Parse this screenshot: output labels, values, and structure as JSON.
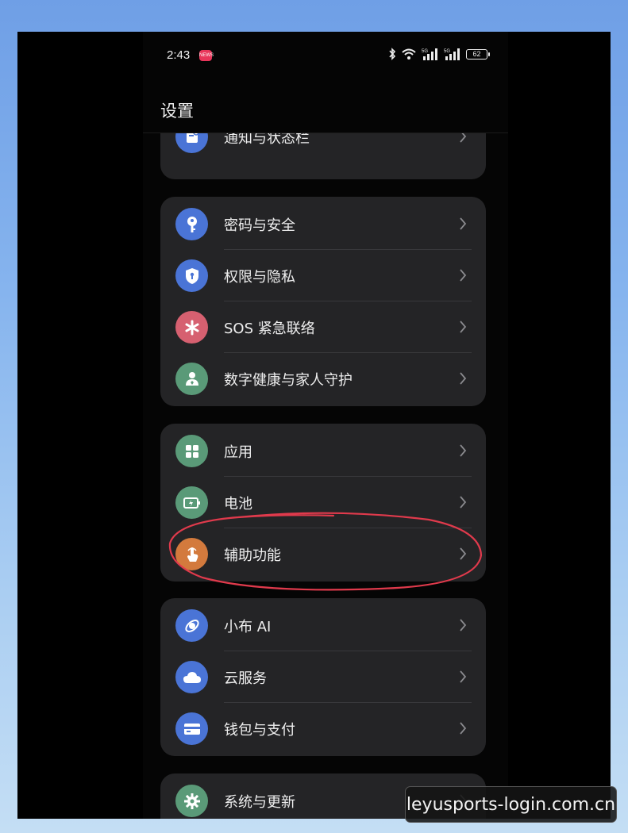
{
  "status_bar": {
    "time": "2:43",
    "notification_badge": "NEWS",
    "network_labels": [
      "5G",
      "5G"
    ],
    "battery": "62"
  },
  "page_title": "设置",
  "groups": [
    {
      "items": [
        {
          "label": "通知与状态栏",
          "icon": "notification-icon",
          "color": "#4a74d6"
        }
      ]
    },
    {
      "items": [
        {
          "label": "密码与安全",
          "icon": "key-icon",
          "color": "#4a74d6"
        },
        {
          "label": "权限与隐私",
          "icon": "shield-icon",
          "color": "#4a74d6"
        },
        {
          "label": "SOS 紧急联络",
          "icon": "asterisk-icon",
          "color": "#d66070"
        },
        {
          "label": "数字健康与家人守护",
          "icon": "family-icon",
          "color": "#5a9a78"
        }
      ]
    },
    {
      "items": [
        {
          "label": "应用",
          "icon": "apps-grid-icon",
          "color": "#5a9a78"
        },
        {
          "label": "电池",
          "icon": "battery-icon",
          "color": "#5a9a78"
        },
        {
          "label": "辅助功能",
          "icon": "hand-pointer-icon",
          "color": "#d37a3d"
        }
      ]
    },
    {
      "items": [
        {
          "label": "小布 AI",
          "icon": "ai-assistant-icon",
          "color": "#4a74d6"
        },
        {
          "label": "云服务",
          "icon": "cloud-icon",
          "color": "#4a74d6"
        },
        {
          "label": "钱包与支付",
          "icon": "wallet-icon",
          "color": "#4a74d6"
        }
      ]
    },
    {
      "items": [
        {
          "label": "系统与更新",
          "icon": "gear-icon",
          "color": "#5a9a78"
        }
      ]
    }
  ],
  "highlighted_item": "辅助功能",
  "annotation_color": "#e03a4c",
  "watermark": "leyusports-login.com.cn"
}
